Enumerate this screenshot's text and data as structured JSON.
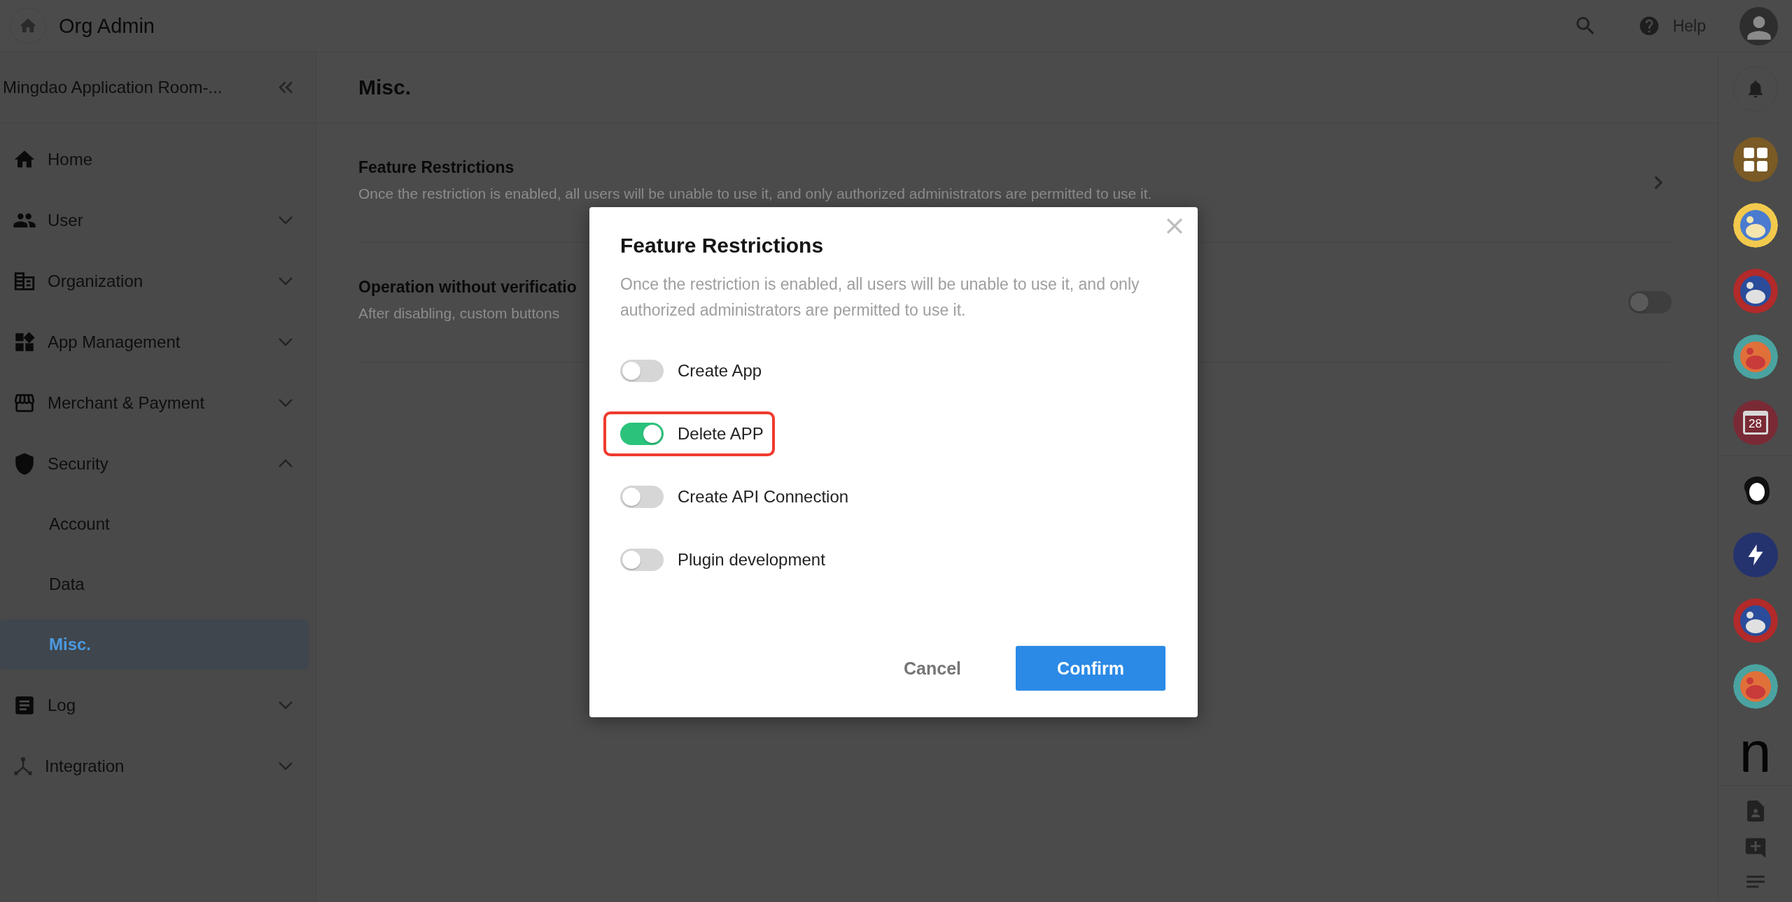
{
  "topbar": {
    "title": "Org Admin",
    "help": "Help"
  },
  "sidebar": {
    "org_name": "Mingdao Application Room-...",
    "items": [
      {
        "label": "Home"
      },
      {
        "label": "User",
        "expanded": false
      },
      {
        "label": "Organization",
        "expanded": false
      },
      {
        "label": "App Management",
        "expanded": false
      },
      {
        "label": "Merchant & Payment",
        "expanded": false
      },
      {
        "label": "Security",
        "expanded": true,
        "children": [
          {
            "label": "Account",
            "selected": false
          },
          {
            "label": "Data",
            "selected": false
          },
          {
            "label": "Misc.",
            "selected": true
          }
        ]
      },
      {
        "label": "Log",
        "expanded": false
      },
      {
        "label": "Integration",
        "expanded": false
      }
    ]
  },
  "main": {
    "title": "Misc.",
    "settings": [
      {
        "kind": "link",
        "title": "Feature Restrictions",
        "description": "Once the restriction is enabled, all users will be unable to use it, and only authorized administrators are permitted to use it."
      },
      {
        "kind": "toggle",
        "title": "Operation without verificatio",
        "description": "After disabling, custom buttons",
        "on": false
      }
    ]
  },
  "rail": {
    "apps": [
      {
        "kind": "grid",
        "color": "#7a5a25"
      },
      {
        "kind": "picture"
      },
      {
        "kind": "picture"
      },
      {
        "kind": "picture"
      },
      {
        "kind": "calendar",
        "color": "#7a2a35",
        "text": "28"
      },
      {
        "kind": "sketch"
      },
      {
        "kind": "lightning",
        "color": "#24336e"
      },
      {
        "kind": "picture"
      },
      {
        "kind": "picture"
      },
      {
        "kind": "letter",
        "text": "n"
      }
    ]
  },
  "dialog": {
    "title": "Feature Restrictions",
    "description": "Once the restriction is enabled, all users will be unable to use it, and only authorized administrators are permitted to use it.",
    "options": [
      {
        "label": "Create App",
        "on": false,
        "highlighted": false
      },
      {
        "label": "Delete APP",
        "on": true,
        "highlighted": true
      },
      {
        "label": "Create API Connection",
        "on": false,
        "highlighted": false
      },
      {
        "label": "Plugin development",
        "on": false,
        "highlighted": false
      }
    ],
    "cancel": "Cancel",
    "confirm": "Confirm"
  }
}
